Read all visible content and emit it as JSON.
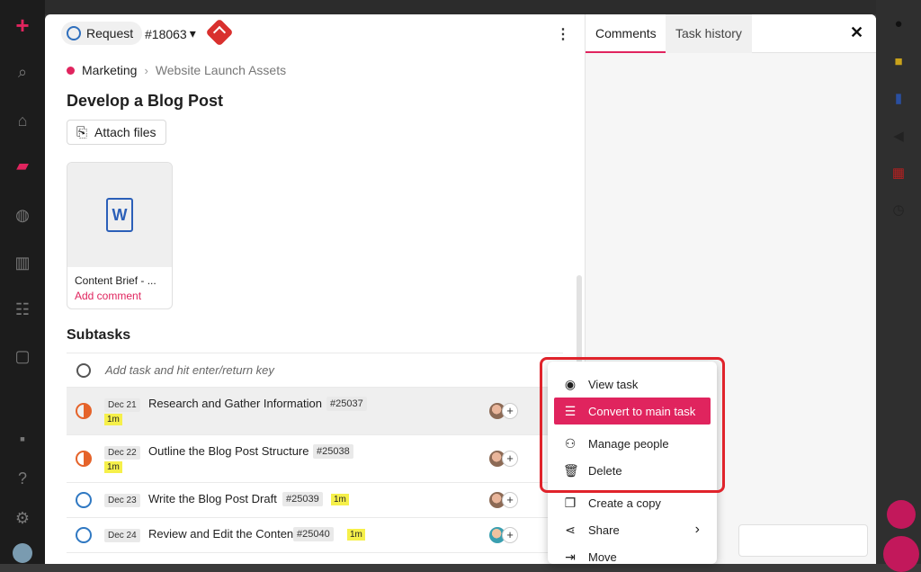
{
  "request_pill": {
    "label": "Request"
  },
  "task_id": {
    "label": "#18063",
    "chevron": "▾"
  },
  "breadcrumb": {
    "project": "Marketing",
    "separator": "›",
    "folder": "Website Launch Assets"
  },
  "task_title": "Develop a Blog Post",
  "attach_button": {
    "label": "Attach files"
  },
  "attachment": {
    "icon_letter": "W",
    "name": "Content Brief - ...",
    "action": "Add comment"
  },
  "subtasks": {
    "heading": "Subtasks",
    "placeholder": "Add task and hit enter/return key",
    "rows": [
      {
        "date": "Dec 21",
        "title": "Research and Gather Information",
        "id": "#25037",
        "time": "1m",
        "status": "in-progress"
      },
      {
        "date": "Dec 22",
        "title": "Outline the Blog Post Structure",
        "id": "#25038",
        "time": "1m",
        "status": "in-progress"
      },
      {
        "date": "Dec 23",
        "title": "Write the Blog Post Draft",
        "id": "#25039",
        "time": "1m",
        "status": "open"
      },
      {
        "date": "Dec 24",
        "title": "Review and Edit the Content",
        "id": "#25040",
        "time": "1m",
        "status": "open"
      }
    ]
  },
  "right_pane": {
    "tabs": [
      {
        "label": "Comments"
      },
      {
        "label": "Task history"
      }
    ],
    "close": "✕"
  },
  "context_menu": {
    "items": [
      {
        "label": "View task",
        "icon": "eye-icon"
      },
      {
        "label": "Convert to main task",
        "icon": "list-icon"
      },
      {
        "label": "Manage people",
        "icon": "people-icon"
      },
      {
        "label": "Delete",
        "icon": "trash-icon"
      },
      {
        "label": "Create a copy",
        "icon": "copy-icon"
      },
      {
        "label": "Share",
        "icon": "share-icon"
      },
      {
        "label": "Move",
        "icon": "move-icon"
      }
    ],
    "share_chevron": "›"
  },
  "plus": "+",
  "colors": {
    "accent": "#e0245e",
    "highlight_box": "#e0232b",
    "status_progress": "#e5632a",
    "status_open": "#2f78c2"
  }
}
